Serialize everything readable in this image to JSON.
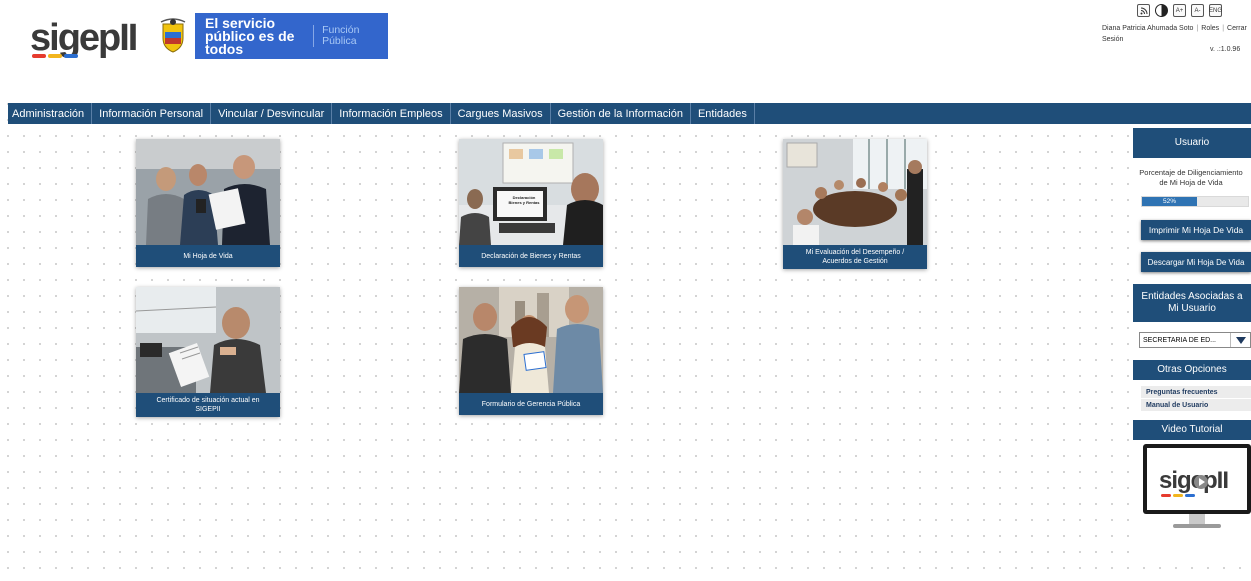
{
  "header": {
    "logo_text": "sigepII",
    "gov_line1": "El servicio público es de todos",
    "gov_line2": "Función Pública",
    "a11y": [
      "rss-icon",
      "contrast-icon",
      "A+",
      "A-",
      "ENG"
    ],
    "user_name": "Diana Patricia Ahumada Soto",
    "roles": "Roles",
    "cerrar": "Cerrar",
    "sesion": "Sesión",
    "version": "v. .:1.0.96"
  },
  "nav": {
    "items": [
      "Administración",
      "Información Personal",
      "Vincular / Desvincular",
      "Información Empleos",
      "Cargues Masivos",
      "Gestión de la Información",
      "Entidades"
    ]
  },
  "tiles": [
    {
      "caption": "Mi Hoja de Vida"
    },
    {
      "caption": "Declaración de Bienes y Rentas",
      "sign": "Declaración Bienes y Rentas"
    },
    {
      "caption": "Mi Evaluación del Desempeño / Acuerdos de Gestión"
    },
    {
      "caption": "Certificado de situación actual en SIGEPII"
    },
    {
      "caption": "Formulario de Gerencia Pública"
    }
  ],
  "sidebar": {
    "usuario_title": "Usuario",
    "pct_label_1": "Porcentaje de Diligenciamiento",
    "pct_label_2": "de Mi Hoja de Vida",
    "progress_value": 52,
    "progress_text": "52%",
    "btn_imprimir": "Imprimir Mi Hoja De Vida",
    "btn_descargar": "Descargar Mi Hoja De Vida",
    "entidades_title": "Entidades Asociadas a Mi Usuario",
    "entidad_selected": "SECRETARIA DE ED...",
    "otras_title": "Otras Opciones",
    "preguntas": "Preguntas frecuentes",
    "manual": "Manual de Usuario",
    "video_title": "Video Tutorial",
    "video_logo": "sigepII"
  },
  "colors": {
    "nav_blue": "#1f4e79",
    "gov_blue": "#3366cc",
    "progress_blue": "#2f73b3"
  }
}
